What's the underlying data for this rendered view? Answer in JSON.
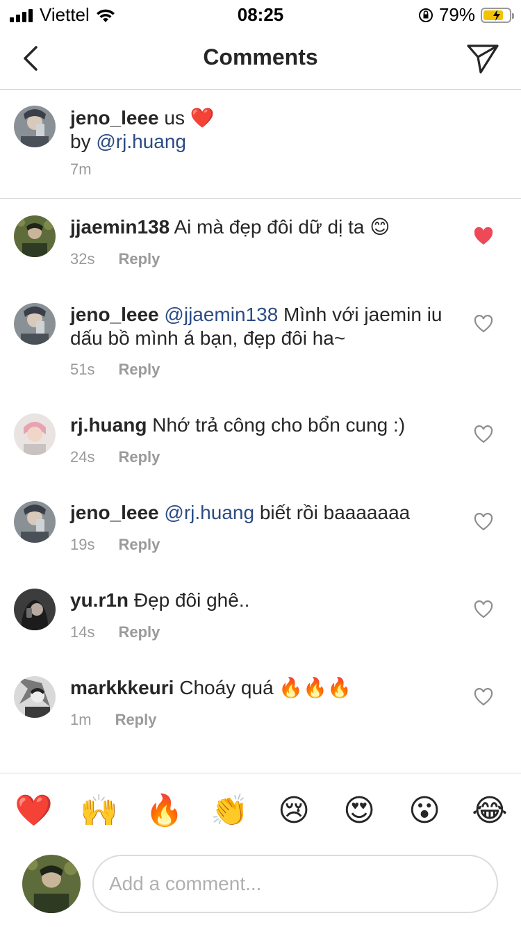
{
  "status": {
    "carrier": "Viettel",
    "time": "08:25",
    "battery": "79%",
    "battery_level": 0.79
  },
  "header": {
    "title": "Comments"
  },
  "caption": {
    "user": "jeno_leee",
    "text": "us ❤️",
    "by_prefix": "by ",
    "by_mention": "@rj.huang",
    "time": "7m"
  },
  "comments": [
    {
      "user": "jjaemin138",
      "mention": "",
      "text": "Ai mà đẹp đôi dữ dị ta 😊",
      "time": "32s",
      "reply": "Reply",
      "liked": true
    },
    {
      "user": "jeno_leee",
      "mention": "@jjaemin138",
      "text": "Mình với jaemin iu dấu bồ mình á bạn, đẹp đôi ha~",
      "time": "51s",
      "reply": "Reply",
      "liked": false
    },
    {
      "user": "rj.huang",
      "mention": "",
      "text": "Nhớ trả công cho bổn cung :)",
      "time": "24s",
      "reply": "Reply",
      "liked": false
    },
    {
      "user": "jeno_leee",
      "mention": "@rj.huang",
      "text": "biết rồi baaaaaaa",
      "time": "19s",
      "reply": "Reply",
      "liked": false
    },
    {
      "user": "yu.r1n",
      "mention": "",
      "text": "Đẹp đôi ghê..",
      "time": "14s",
      "reply": "Reply",
      "liked": false
    },
    {
      "user": "markkkeuri",
      "mention": "",
      "text": "Choáy quá 🔥🔥🔥",
      "time": "1m",
      "reply": "Reply",
      "liked": false
    }
  ],
  "emoji_bar": [
    "❤️",
    "🙌",
    "🔥",
    "👏",
    "😢",
    "😍",
    "😮",
    "😂"
  ],
  "input": {
    "placeholder": "Add a comment..."
  },
  "colors": {
    "mention": "#2b4b84",
    "liked_heart": "#ed4956",
    "meta": "#9a9a9a"
  }
}
